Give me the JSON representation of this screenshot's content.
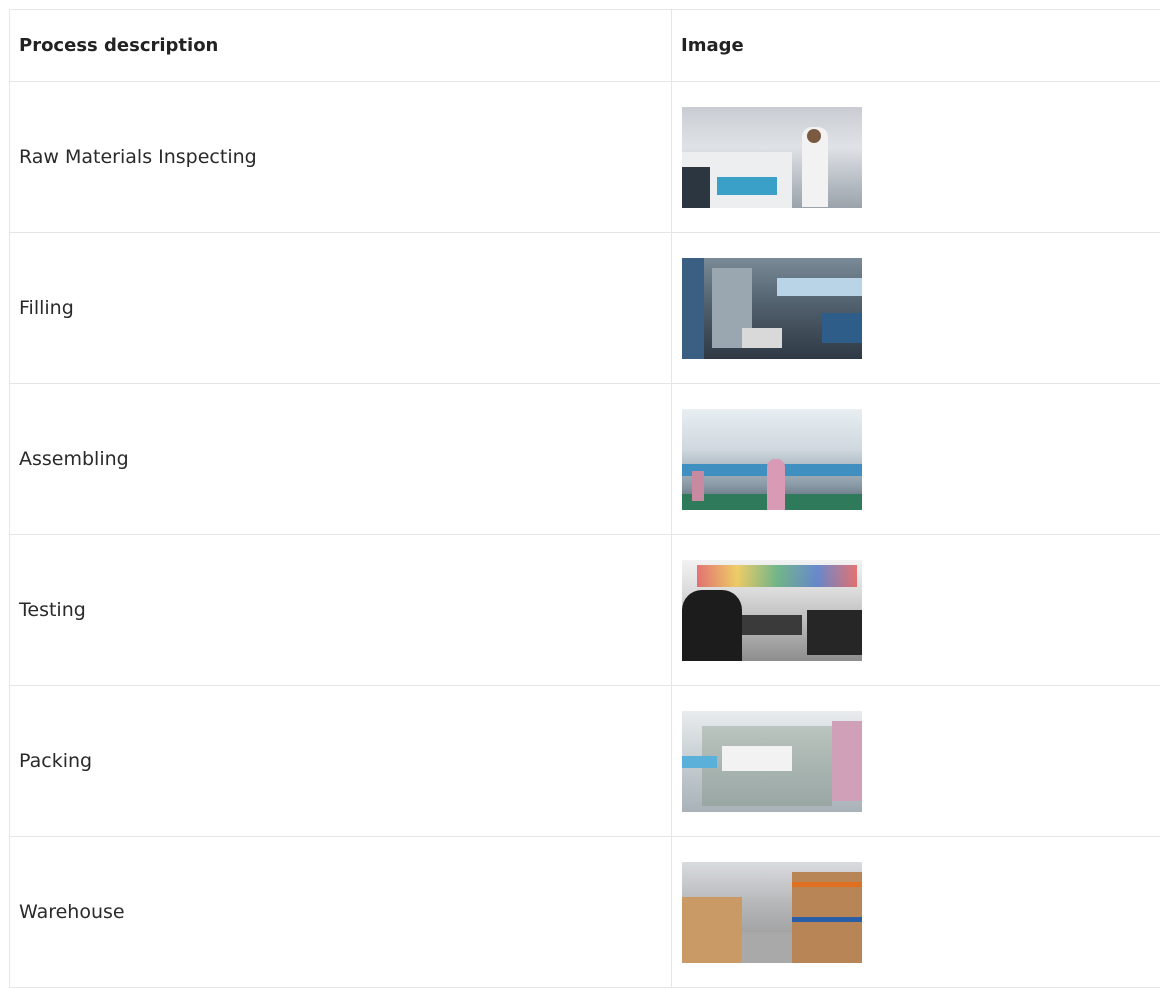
{
  "table": {
    "headers": {
      "description": "Process description",
      "image": "Image"
    },
    "rows": [
      {
        "description": "Raw Materials Inspecting",
        "image": "raw-materials-inspecting-photo"
      },
      {
        "description": "Filling",
        "image": "filling-photo"
      },
      {
        "description": "Assembling",
        "image": "assembling-photo"
      },
      {
        "description": "Testing",
        "image": "testing-photo"
      },
      {
        "description": "Packing",
        "image": "packing-photo"
      },
      {
        "description": "Warehouse",
        "image": "warehouse-photo"
      }
    ]
  }
}
